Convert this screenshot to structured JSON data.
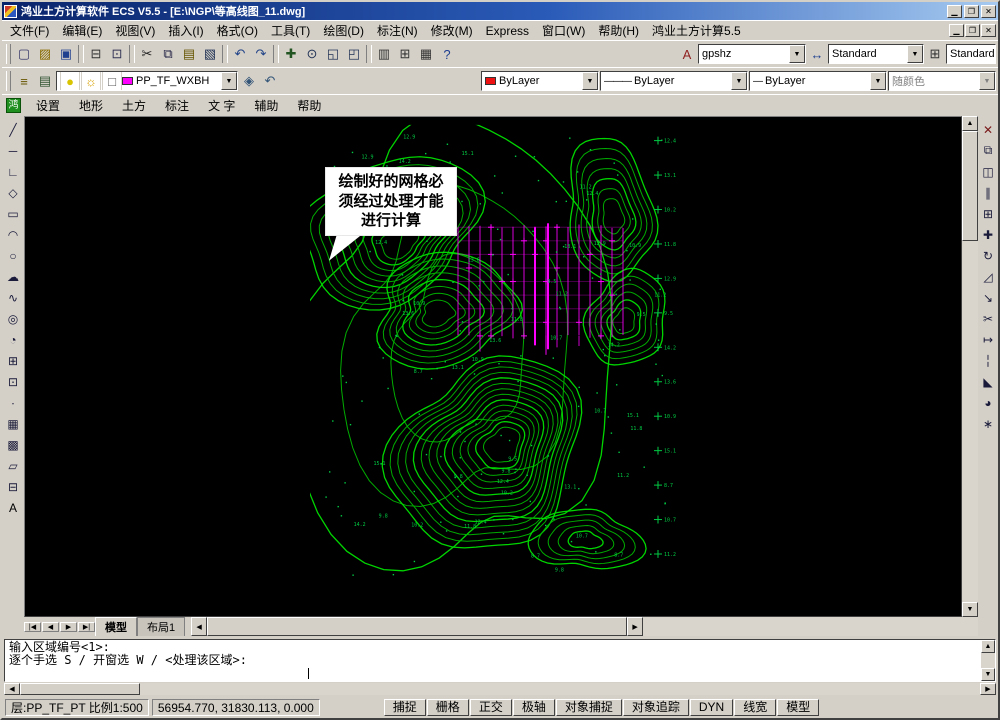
{
  "titlebar": {
    "title": "鸿业土方计算软件 ECS V5.5 - [E:\\NGP\\等高线图_11.dwg]",
    "window_buttons": [
      {
        "n": "minimize-button",
        "g": "▁",
        "c": "#000"
      },
      {
        "n": "maximize-button",
        "g": "❐",
        "c": "#000"
      },
      {
        "n": "close-button",
        "g": "✕",
        "c": "#000"
      }
    ]
  },
  "menubar": {
    "items": [
      "文件(F)",
      "编辑(E)",
      "视图(V)",
      "插入(I)",
      "格式(O)",
      "工具(T)",
      "绘图(D)",
      "标注(N)",
      "修改(M)",
      "Express",
      "窗口(W)",
      "帮助(H)",
      "鸿业土方计算5.5"
    ],
    "doc_buttons": [
      {
        "n": "doc-minimize-button",
        "g": "▁",
        "c": "#000"
      },
      {
        "n": "doc-restore-button",
        "g": "❐",
        "c": "#000"
      },
      {
        "n": "doc-close-button",
        "g": "✕",
        "c": "#000"
      }
    ]
  },
  "toolbar_standard": {
    "icons": [
      {
        "n": "new-file-icon",
        "g": "▢",
        "c": "#3a3a6a"
      },
      {
        "n": "open-folder-icon",
        "g": "▨",
        "c": "#8a6d00"
      },
      {
        "n": "save-icon",
        "g": "▣",
        "c": "#1f3f8f"
      },
      {
        "sep": true
      },
      {
        "n": "plot-icon",
        "g": "⊟",
        "c": "#333333"
      },
      {
        "n": "plot-preview-icon",
        "g": "⊡",
        "c": "#333355"
      },
      {
        "sep": true
      },
      {
        "n": "cut-icon",
        "g": "✂",
        "c": "#222222"
      },
      {
        "n": "copy-icon",
        "g": "⧉",
        "c": "#222244"
      },
      {
        "n": "paste-icon",
        "g": "▤",
        "c": "#665500"
      },
      {
        "n": "match-properties-icon",
        "g": "▧",
        "c": "#223355"
      },
      {
        "sep": true
      },
      {
        "n": "undo-icon",
        "g": "↶",
        "c": "#224488"
      },
      {
        "n": "redo-icon",
        "g": "↷",
        "c": "#224488"
      },
      {
        "sep": true
      },
      {
        "n": "pan-icon",
        "g": "✚",
        "c": "#225522"
      },
      {
        "n": "zoom-realtime-icon",
        "g": "⊙",
        "c": "#223355"
      },
      {
        "n": "zoom-window-icon",
        "g": "◱",
        "c": "#223355"
      },
      {
        "n": "zoom-previous-icon",
        "g": "◰",
        "c": "#223355"
      },
      {
        "sep": true
      },
      {
        "n": "properties-icon",
        "g": "▥",
        "c": "#333333"
      },
      {
        "n": "designcenter-icon",
        "g": "⊞",
        "c": "#333333"
      },
      {
        "n": "toolpalettes-icon",
        "g": "▦",
        "c": "#333333"
      },
      {
        "n": "help-icon",
        "g": "?",
        "c": "#1f3f8f"
      }
    ],
    "text_style_icon": {
      "n": "text-style-icon",
      "g": "A",
      "c": "#8f1f1f"
    },
    "text_style": "gpshz",
    "dim_style_icon": {
      "n": "dim-style-icon",
      "g": "↔",
      "c": "#1f3f8f"
    },
    "dim_style": "Standard",
    "table_style_icon": {
      "n": "table-style-icon",
      "g": "⊞",
      "c": "#333333"
    },
    "table_style": "Standard"
  },
  "toolbar_properties": {
    "icons_left": [
      {
        "n": "layer-manager-icon",
        "g": "≡",
        "c": "#665500"
      },
      {
        "n": "layer-states-icon",
        "g": "▤",
        "c": "#335533"
      }
    ],
    "layer": {
      "value": "PP_TF_WXBH",
      "chip_color": "#ff00ff",
      "state_icons": [
        {
          "n": "layer-on-icon",
          "g": "●",
          "c": "#d8c400"
        },
        {
          "n": "layer-thaw-icon",
          "g": "☼",
          "c": "#d8a000"
        },
        {
          "n": "layer-unlock-icon",
          "g": "□",
          "c": "#555555"
        }
      ]
    },
    "icons_right": [
      {
        "n": "make-object-layer-current-icon",
        "g": "◈",
        "c": "#335577"
      },
      {
        "n": "previous-layer-icon",
        "g": "↶",
        "c": "#335577"
      }
    ],
    "color": {
      "value": "ByLayer",
      "chip_color": "#ee1111"
    },
    "linetype": {
      "value": "ByLayer",
      "sample": "———"
    },
    "lineweight": {
      "value": "ByLayer",
      "sample": "—"
    },
    "plot_style": {
      "value": "随颜色"
    }
  },
  "app_menubar": {
    "logo_glyph": "鸿",
    "items": [
      "设置",
      "地形",
      "土方",
      "标注",
      "文 字",
      "辅助",
      "帮助"
    ]
  },
  "left_toolbar": {
    "icons": [
      {
        "n": "line-icon",
        "g": "╱",
        "c": "#1a1a3a"
      },
      {
        "n": "xline-icon",
        "g": "─",
        "c": "#1a1a3a"
      },
      {
        "n": "polyline-icon",
        "g": "∟",
        "c": "#1a1a3a"
      },
      {
        "n": "polygon-icon",
        "g": "◇",
        "c": "#1a1a3a"
      },
      {
        "n": "rectangle-icon",
        "g": "▭",
        "c": "#1a1a3a"
      },
      {
        "n": "arc-icon",
        "g": "◠",
        "c": "#1a1a3a"
      },
      {
        "n": "circle-icon",
        "g": "○",
        "c": "#1a1a3a"
      },
      {
        "n": "revcloud-icon",
        "g": "☁",
        "c": "#1a1a3a"
      },
      {
        "n": "spline-icon",
        "g": "∿",
        "c": "#1a1a3a"
      },
      {
        "n": "ellipse-icon",
        "g": "◎",
        "c": "#1a1a3a"
      },
      {
        "n": "ellipse-arc-icon",
        "g": "◔",
        "c": "#1a1a3a"
      },
      {
        "n": "insert-block-icon",
        "g": "⊞",
        "c": "#1a1a3a"
      },
      {
        "n": "make-block-icon",
        "g": "⊡",
        "c": "#1a1a3a"
      },
      {
        "n": "point-icon",
        "g": "∙",
        "c": "#1a1a3a"
      },
      {
        "n": "hatch-icon",
        "g": "▦",
        "c": "#1a1a3a"
      },
      {
        "n": "gradient-icon",
        "g": "▩",
        "c": "#1a1a3a"
      },
      {
        "n": "region-icon",
        "g": "▱",
        "c": "#1a1a3a"
      },
      {
        "n": "table-icon",
        "g": "⊟",
        "c": "#1a1a3a"
      },
      {
        "n": "mtext-icon",
        "g": "A",
        "c": "#000000"
      }
    ]
  },
  "right_toolbar": {
    "icons": [
      {
        "n": "erase-icon",
        "g": "✕",
        "c": "#7a1a1a"
      },
      {
        "n": "copy-object-icon",
        "g": "⧉",
        "c": "#1a1a3a"
      },
      {
        "n": "mirror-icon",
        "g": "◫",
        "c": "#1a1a3a"
      },
      {
        "n": "offset-icon",
        "g": "∥",
        "c": "#1a1a3a"
      },
      {
        "n": "array-icon",
        "g": "⊞",
        "c": "#1a1a3a"
      },
      {
        "n": "move-icon",
        "g": "✚",
        "c": "#1a1a3a"
      },
      {
        "n": "rotate-icon",
        "g": "↻",
        "c": "#1a1a3a"
      },
      {
        "n": "scale-icon",
        "g": "◿",
        "c": "#1a1a3a"
      },
      {
        "n": "stretch-icon",
        "g": "↘",
        "c": "#1a1a3a"
      },
      {
        "n": "trim-icon",
        "g": "✂",
        "c": "#1a1a3a"
      },
      {
        "n": "extend-icon",
        "g": "↦",
        "c": "#1a1a3a"
      },
      {
        "n": "break-icon",
        "g": "╎",
        "c": "#1a1a3a"
      },
      {
        "n": "chamfer-icon",
        "g": "◣",
        "c": "#1a1a3a"
      },
      {
        "n": "fillet-icon",
        "g": "◕",
        "c": "#1a1a3a"
      },
      {
        "n": "explode-icon",
        "g": "∗",
        "c": "#1a1a3a"
      }
    ]
  },
  "canvas": {
    "callout_text": "绘制好的网格必须经过处理才能进行计算",
    "elevation_labels": [
      "10.7",
      "11.2",
      "9.8",
      "12.4",
      "13.1",
      "10.2",
      "11.8",
      "12.9",
      "9.5",
      "14.2",
      "13.6",
      "10.9",
      "15.1",
      "8.7"
    ],
    "colors": {
      "background": "#000000",
      "contour": "#00b400",
      "contour_index": "#00e000",
      "points": "#00cc44",
      "grid": "#ff00ff"
    }
  },
  "tabs": {
    "nav": [
      "|◀",
      "◀",
      "▶",
      "▶|"
    ],
    "items": [
      {
        "label": "模型",
        "active": true
      },
      {
        "label": "布局1",
        "active": false
      }
    ]
  },
  "command": {
    "lines": [
      "输入区域编号<1>:",
      "逐个手选 S / 开窗选 W / <处理该区域>:"
    ]
  },
  "statusbar": {
    "layer_scale": "层:PP_TF_PT 比例1:500",
    "coordinates": "56954.770, 31830.113, 0.000",
    "toggles": [
      "捕捉",
      "栅格",
      "正交",
      "极轴",
      "对象捕捉",
      "对象追踪",
      "DYN",
      "线宽",
      "模型"
    ]
  }
}
